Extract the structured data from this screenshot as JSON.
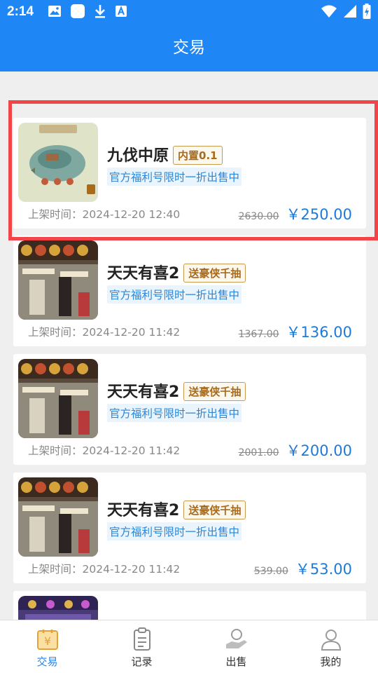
{
  "status_bar": {
    "time": "2:14",
    "left_icons": [
      "image-icon",
      "app-square-icon",
      "download-icon",
      "translate-icon"
    ],
    "right_icons": [
      "wifi-icon",
      "cell-signal-icon",
      "battery-charging-icon"
    ]
  },
  "header": {
    "title": "交易"
  },
  "listings": [
    {
      "name": "九伐中原",
      "tag": "内置0.1",
      "promo": "官方福利号限时一折出售中",
      "listed_label": "上架时间：",
      "listed_time": "2024-12-20 12:40",
      "original_price": "2630.00",
      "price": "￥250.00",
      "selected": true
    },
    {
      "name": "天天有喜2",
      "tag": "送豪侠千抽",
      "promo": "官方福利号限时一折出售中",
      "listed_label": "上架时间：",
      "listed_time": "2024-12-20 11:42",
      "original_price": "1367.00",
      "price": "￥136.00"
    },
    {
      "name": "天天有喜2",
      "tag": "送豪侠千抽",
      "promo": "官方福利号限时一折出售中",
      "listed_label": "上架时间：",
      "listed_time": "2024-12-20 11:42",
      "original_price": "2001.00",
      "price": "￥200.00"
    },
    {
      "name": "天天有喜2",
      "tag": "送豪侠千抽",
      "promo": "官方福利号限时一折出售中",
      "listed_label": "上架时间：",
      "listed_time": "2024-12-20 11:42",
      "original_price": "539.00",
      "price": "￥53.00"
    }
  ],
  "tabbar": {
    "tabs": [
      {
        "label": "交易",
        "icon": "yen-tag-icon",
        "active": true
      },
      {
        "label": "记录",
        "icon": "clipboard-icon"
      },
      {
        "label": "出售",
        "icon": "hand-coin-icon"
      },
      {
        "label": "我的",
        "icon": "user-icon"
      }
    ]
  },
  "colors": {
    "primary": "#1e86f5",
    "price": "#1e7ad8",
    "tag_border": "#c89a50",
    "highlight": "#f2454a"
  }
}
